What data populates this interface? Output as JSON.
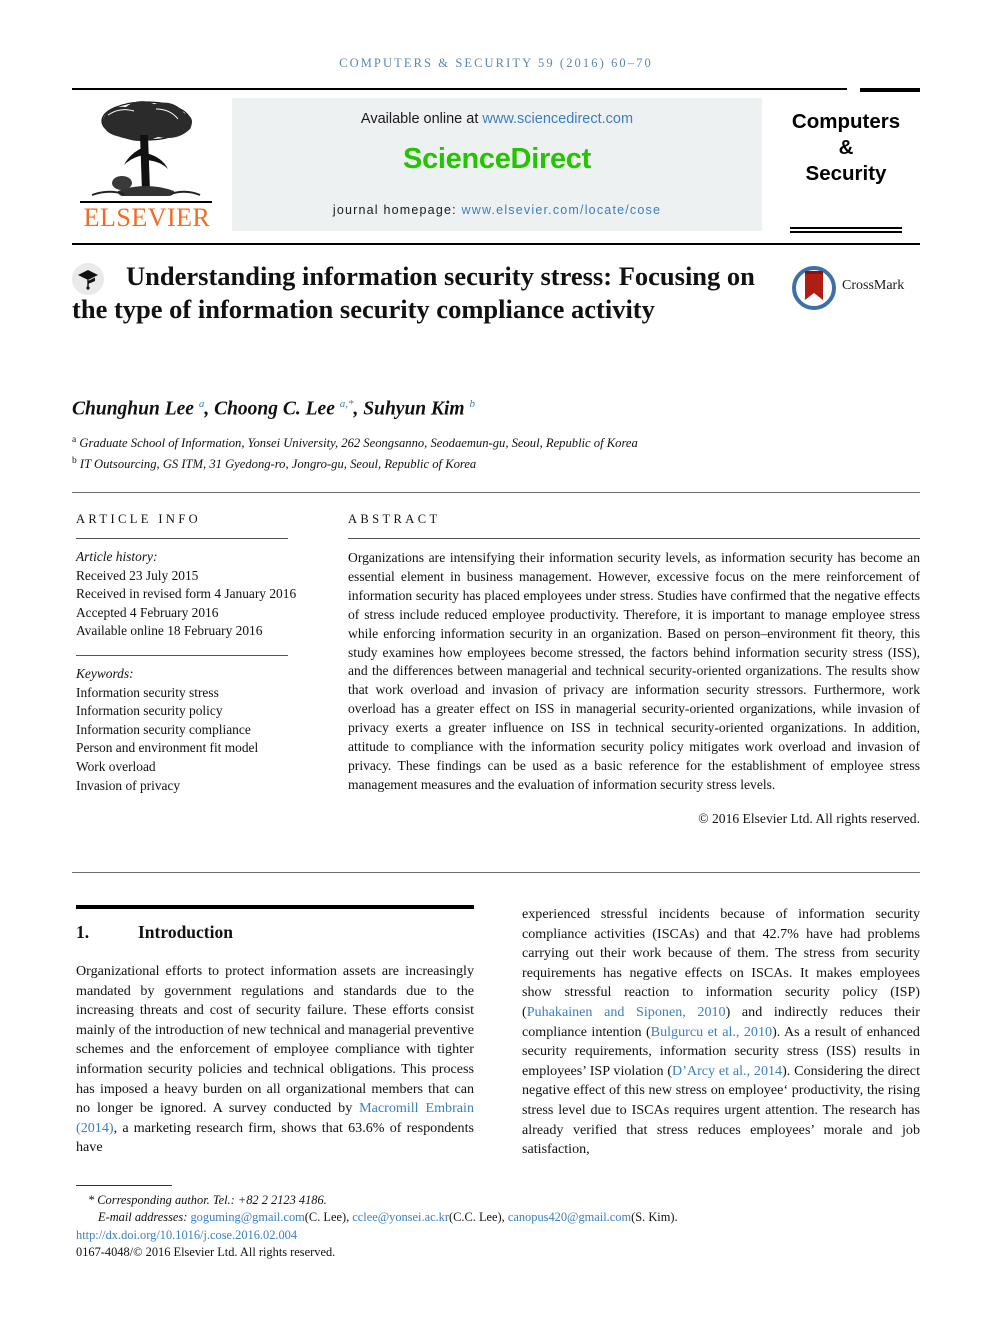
{
  "running_head": "COMPUTERS & SECURITY 59 (2016) 60–70",
  "masthead": {
    "elsevier_wordmark": "ELSEVIER",
    "available_label": "Available online at",
    "sciencedirect_url": "www.sciencedirect.com",
    "sciencedirect_logo": "ScienceDirect",
    "homepage_label": "journal homepage:",
    "homepage_url": "www.elsevier.com/locate/cose",
    "journal_line1": "Computers",
    "journal_line2": "&",
    "journal_line3": "Security",
    "colors": {
      "elsevier_orange": "#F26B21",
      "sciencedirect_green": "#25c400",
      "link_blue": "#3a7fc1",
      "banner_bg": "#eef1f2",
      "runhead_blue": "#5b87ae"
    }
  },
  "article": {
    "title": "Understanding information security stress: Focusing on the type of information security compliance activity",
    "crossmark_label": "CrossMark",
    "authors_html": "Chunghun Lee <sup>a</sup>, Choong C. Lee <sup>a,*</sup>, Suhyun Kim <sup>b</sup>",
    "affiliations": [
      {
        "marker": "a",
        "text": "Graduate School of Information, Yonsei University, 262 Seongsanno, Seodaemun-gu, Seoul, Republic of Korea"
      },
      {
        "marker": "b",
        "text": "IT Outsourcing, GS ITM, 31 Gyedong-ro, Jongro-gu, Seoul, Republic of Korea"
      }
    ]
  },
  "info": {
    "heading": "ARTICLE INFO",
    "history_label": "Article history:",
    "history": [
      "Received 23 July 2015",
      "Received in revised form 4 January 2016",
      "Accepted 4 February 2016",
      "Available online 18 February 2016"
    ],
    "keywords_label": "Keywords:",
    "keywords": [
      "Information security stress",
      "Information security policy",
      "Information security compliance",
      "Person and environment fit model",
      "Work overload",
      "Invasion of privacy"
    ]
  },
  "abstract": {
    "heading": "ABSTRACT",
    "text": "Organizations are intensifying their information security levels, as information security has become an essential element in business management. However, excessive focus on the mere reinforcement of information security has placed employees under stress. Studies have confirmed that the negative effects of stress include reduced employee productivity. Therefore, it is important to manage employee stress while enforcing information security in an organization. Based on person–environment fit theory, this study examines how employees become stressed, the factors behind information security stress (ISS), and the differences between managerial and technical security-oriented organizations. The results show that work overload and invasion of privacy are information security stressors. Furthermore, work overload has a greater effect on ISS in managerial security-oriented organizations, while invasion of privacy exerts a greater influence on ISS in technical security-oriented organizations. In addition, attitude to compliance with the information security policy mitigates work overload and invasion of privacy. These findings can be used as a basic reference for the establishment of employee stress management measures and the evaluation of information security stress levels.",
    "copyright": "© 2016 Elsevier Ltd. All rights reserved."
  },
  "introduction": {
    "number": "1.",
    "heading": "Introduction",
    "left_html": "Organizational efforts to protect information assets are increasingly mandated by government regulations and standards due to the increasing threats and cost of security failure. These efforts consist mainly of the introduction of new technical and managerial preventive schemes and the enforcement of employee compliance with tighter information security policies and technical obligations. This process has imposed a heavy burden on all organizational members that can no longer be ignored. A survey conducted by <a class=\"ref\" href=\"#\" data-name=\"citation-link\">Macromill Embrain (2014)</a>, a marketing research firm, shows that 63.6% of respondents have",
    "right_html": "experienced stressful incidents because of information security compliance activities (ISCAs) and that 42.7% have had problems carrying out their work because of them. The stress from security requirements has negative effects on ISCAs. It makes employees show stressful reaction to information security policy (ISP) (<a class=\"ref\" href=\"#\" data-name=\"citation-link\">Puhakainen and Siponen, 2010</a>) and indirectly reduces their compliance intention (<a class=\"ref\" href=\"#\" data-name=\"citation-link\">Bulgurcu et al., 2010</a>). As a result of enhanced security requirements, information security stress (ISS) results in employees’ ISP violation (<a class=\"ref\" href=\"#\" data-name=\"citation-link\">D’Arcy et al., 2014</a>). Considering the direct negative effect of this new stress on employee‘ productivity, the rising stress level due to ISCAs requires urgent attention. The research has already verified that stress reduces employees’ morale and job satisfaction,"
  },
  "footnote": {
    "corresponding": "* Corresponding author. Tel.: +82 2 2123 4186.",
    "emails_label": "E-mail addresses:",
    "emails": [
      {
        "address": "goguming@gmail.com",
        "name": "(C. Lee)"
      },
      {
        "address": "cclee@yonsei.ac.kr",
        "name": "(C.C. Lee)"
      },
      {
        "address": "canopus420@gmail.com",
        "name": "(S. Kim)."
      }
    ],
    "doi": "http://dx.doi.org/10.1016/j.cose.2016.02.004",
    "issn_line": "0167-4048/© 2016 Elsevier Ltd. All rights reserved."
  }
}
